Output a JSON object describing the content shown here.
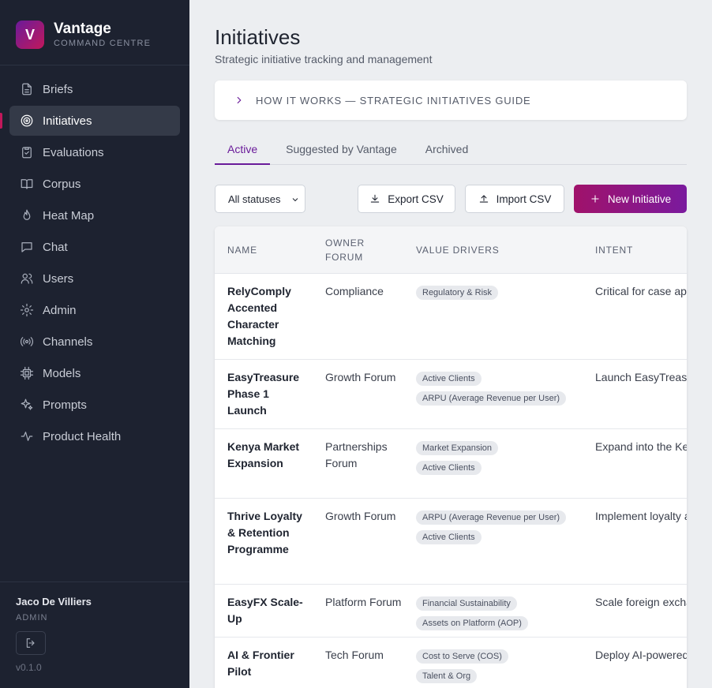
{
  "app": {
    "name": "Vantage",
    "subtitle": "COMMAND CENTRE",
    "logo_letter": "V",
    "brand_colors": [
      "#6a1b9a",
      "#c2185b"
    ]
  },
  "sidebar": {
    "items": [
      {
        "label": "Briefs",
        "icon": "document-icon"
      },
      {
        "label": "Initiatives",
        "icon": "target-icon",
        "active": true
      },
      {
        "label": "Evaluations",
        "icon": "clipboard-check-icon"
      },
      {
        "label": "Corpus",
        "icon": "book-open-icon"
      },
      {
        "label": "Heat Map",
        "icon": "flame-icon"
      },
      {
        "label": "Chat",
        "icon": "chat-bubble-icon"
      },
      {
        "label": "Users",
        "icon": "users-icon"
      },
      {
        "label": "Admin",
        "icon": "gear-icon"
      },
      {
        "label": "Channels",
        "icon": "broadcast-icon"
      },
      {
        "label": "Models",
        "icon": "cpu-icon"
      },
      {
        "label": "Prompts",
        "icon": "sparkles-icon"
      },
      {
        "label": "Product Health",
        "icon": "activity-icon"
      }
    ],
    "user": {
      "name": "Jaco De Villiers",
      "role": "ADMIN"
    },
    "version": "v0.1.0"
  },
  "page": {
    "title": "Initiatives",
    "subtitle": "Strategic initiative tracking and management",
    "guide_label": "HOW IT WORKS — STRATEGIC INITIATIVES GUIDE"
  },
  "tabs": [
    {
      "label": "Active",
      "active": true
    },
    {
      "label": "Suggested by Vantage"
    },
    {
      "label": "Archived"
    }
  ],
  "toolbar": {
    "status_filter": "All statuses",
    "export_label": "Export CSV",
    "import_label": "Import CSV",
    "new_label": "New Initiative"
  },
  "table": {
    "headers": {
      "name": "NAME",
      "owner_forum": "OWNER FORUM",
      "value_drivers": "VALUE DRIVERS",
      "intent": "INTENT"
    },
    "rows": [
      {
        "name": "RelyComply Accented Character Matching",
        "forum": "Compliance",
        "drivers": [
          "Regulatory & Risk"
        ],
        "intent": "Critical for case app"
      },
      {
        "name": "EasyTreasure Phase 1 Launch",
        "forum": "Growth Forum",
        "drivers": [
          "Active Clients",
          "ARPU (Average Revenue per User)"
        ],
        "intent": "Launch EasyTreasu"
      },
      {
        "name": "Kenya Market Expansion",
        "forum": "Partnerships Forum",
        "drivers": [
          "Market Expansion",
          "Active Clients"
        ],
        "intent": "Expand into the Ke"
      },
      {
        "name": "Thrive Loyalty & Retention Programme",
        "forum": "Growth Forum",
        "drivers": [
          "ARPU (Average Revenue per User)",
          "Active Clients"
        ],
        "intent": "Implement loyalty a"
      },
      {
        "name": "EasyFX Scale-Up",
        "forum": "Platform Forum",
        "drivers": [
          "Financial Sustainability",
          "Assets on Platform (AOP)"
        ],
        "intent": "Scale foreign excha"
      },
      {
        "name": "AI & Frontier Pilot",
        "forum": "Tech Forum",
        "drivers": [
          "Cost to Serve (COS)",
          "Talent & Org"
        ],
        "intent": "Deploy AI-powered"
      }
    ]
  }
}
